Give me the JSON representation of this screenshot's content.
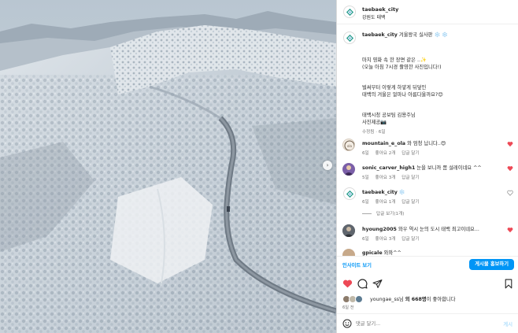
{
  "header": {
    "username": "taebaek_city",
    "location": "강원도 태백",
    "more_icon": "more-horizontal-icon"
  },
  "caption": {
    "username": "taebaek_city",
    "text": "겨울왕국 실사판 ❄️ ❄️",
    "lines": [
      "마치 영화 속 한 장면 같은 ..✨",
      "(오늘 아침 7시경 촬영한 사진입니다!)",
      "",
      "벌써부터 이렇게 하얗게 뒤덮인",
      "태백의 겨울은 얼마나 아름다울까요?😊",
      "",
      "태백시청 공보팀 김용주님",
      "사진제공📷"
    ],
    "meta": "수정됨 · 6일"
  },
  "comments": [
    {
      "username": "mountain_e_ola",
      "text": "와 엄청 납니다..😍",
      "time": "6일",
      "likes": "좋아요 2개",
      "reply": "답글 달기"
    },
    {
      "username": "sonic_carver_high1",
      "text": "눈을 보니까 쫌 설레이네요 ^^",
      "time": "5일",
      "likes": "좋아요 3개",
      "reply": "답글 달기"
    },
    {
      "username": "taebaek_city",
      "text": "❄️",
      "time": "6일",
      "likes": "좋아요 1개",
      "reply": "답글 달기",
      "view_replies": "답글 보기(1개)"
    },
    {
      "username": "hyoung2005",
      "text": "와우 역시 눈의 도시 태백 최고이네요...",
      "time": "6일",
      "likes": "좋아요 3개",
      "reply": "답글 달기"
    },
    {
      "username": "gpicale",
      "text": "와와^^",
      "time": "",
      "likes": "",
      "reply": ""
    }
  ],
  "actions": {
    "insight_label": "인사이트 보기",
    "promote_label": "게시물 홍보하기"
  },
  "likes": {
    "prefix": "youngae_ss님 ",
    "bold": "외 668명",
    "suffix": "이 좋아합니다"
  },
  "date": "6일 전",
  "add_comment": {
    "placeholder": "댓글 달기...",
    "post_label": "게시"
  },
  "colors": {
    "accent": "#0095f6",
    "like_red": "#ed4956",
    "brand_teal": "#2a9d8f"
  }
}
